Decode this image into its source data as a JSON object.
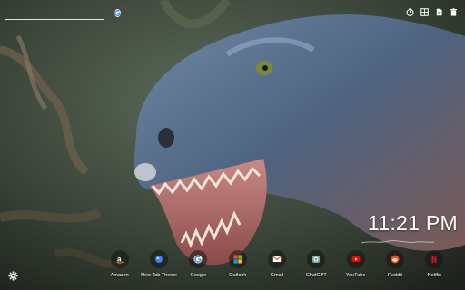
{
  "search": {
    "placeholder": "",
    "value": ""
  },
  "top_icons": [
    "timer-icon",
    "grid-icon",
    "file-icon",
    "trash-icon"
  ],
  "clock": {
    "time": "11:21 PM"
  },
  "dock": {
    "apps": [
      {
        "label": "Amazon",
        "icon": "amazon-icon"
      },
      {
        "label": "New Tab Theme",
        "icon": "new-tab-theme-icon"
      },
      {
        "label": "Google",
        "icon": "google-icon"
      },
      {
        "label": "Outlook",
        "icon": "outlook-icon"
      },
      {
        "label": "Gmail",
        "icon": "gmail-icon"
      },
      {
        "label": "ChatGPT",
        "icon": "chatgpt-icon"
      },
      {
        "label": "YouTube",
        "icon": "youtube-icon"
      },
      {
        "label": "Reddit",
        "icon": "reddit-icon"
      },
      {
        "label": "Netflix",
        "icon": "netflix-icon"
      }
    ]
  },
  "colors": {
    "youtube": "#ff0000",
    "gmail": "#ea4335",
    "reddit": "#ff4500",
    "netflix": "#e50914",
    "chatgpt": "#74aa9c",
    "new_tab_theme": "#3b82f6"
  }
}
